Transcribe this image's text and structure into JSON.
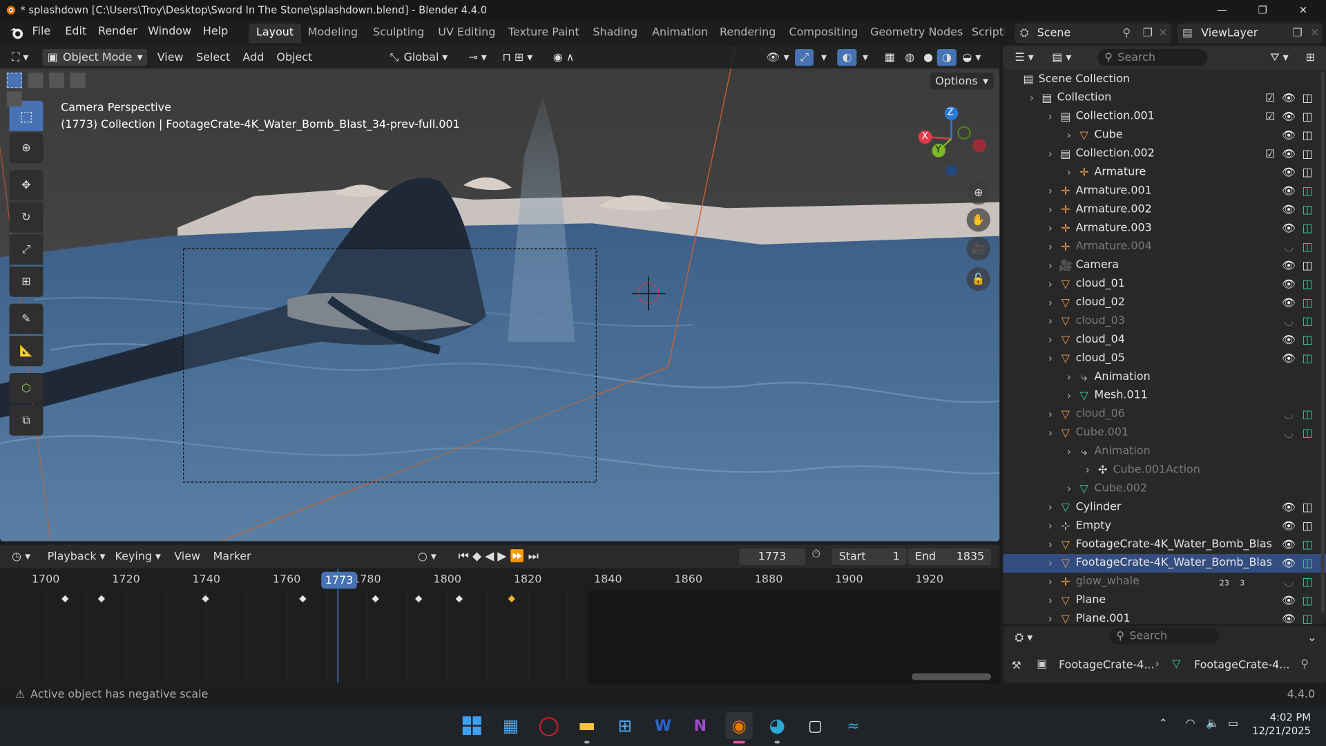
{
  "window": {
    "title": "* splashdown [C:\\Users\\Troy\\Desktop\\Sword In The Stone\\splashdown.blend] - Blender 4.4.0",
    "min": "—",
    "max": "❐",
    "close": "✕"
  },
  "menu": [
    "File",
    "Edit",
    "Render",
    "Window",
    "Help"
  ],
  "workspaces": [
    "Layout",
    "Modeling",
    "Sculpting",
    "UV Editing",
    "Texture Paint",
    "Shading",
    "Animation",
    "Rendering",
    "Compositing",
    "Geometry Nodes",
    "Scripti"
  ],
  "scene": {
    "name": "Scene",
    "viewlayer": "ViewLayer"
  },
  "viewport": {
    "mode": "Object Mode",
    "menus": [
      "View",
      "Select",
      "Add",
      "Object"
    ],
    "orientation": "Global",
    "options": "Options",
    "overlay_title": "Camera Perspective",
    "overlay_sub": "(1773) Collection | FootageCrate-4K_Water_Bomb_Blast_34-prev-full.001",
    "gizmo": {
      "z": "Z",
      "y": "Y",
      "x": "X"
    }
  },
  "timeline": {
    "menus": [
      "Playback",
      "Keying",
      "View",
      "Marker"
    ],
    "current_frame": "1773",
    "start_label": "Start",
    "start": "1",
    "end_label": "End",
    "end": "1835",
    "ticks": [
      "1700",
      "1720",
      "1740",
      "1760",
      "1780",
      "1800",
      "1820",
      "1840",
      "1860",
      "1880",
      "1900",
      "1920"
    ]
  },
  "status": {
    "message": "Active object has negative scale",
    "version": "4.4.0"
  },
  "outliner": {
    "search_placeholder": "Search",
    "rows": [
      {
        "name": "Scene Collection",
        "indent": 0
      },
      {
        "name": "Collection",
        "indent": 1
      },
      {
        "name": "Collection.001",
        "indent": 2
      },
      {
        "name": "Cube",
        "indent": 3
      },
      {
        "name": "Collection.002",
        "indent": 2
      },
      {
        "name": "Armature",
        "indent": 3
      },
      {
        "name": "Armature.001",
        "indent": 2
      },
      {
        "name": "Armature.002",
        "indent": 2
      },
      {
        "name": "Armature.003",
        "indent": 2
      },
      {
        "name": "Armature.004",
        "indent": 2,
        "dim": true
      },
      {
        "name": "Camera",
        "indent": 2
      },
      {
        "name": "cloud_01",
        "indent": 2
      },
      {
        "name": "cloud_02",
        "indent": 2
      },
      {
        "name": "cloud_03",
        "indent": 2,
        "dim": true
      },
      {
        "name": "cloud_04",
        "indent": 2
      },
      {
        "name": "cloud_05",
        "indent": 2
      },
      {
        "name": "Animation",
        "indent": 3
      },
      {
        "name": "Mesh.011",
        "indent": 3
      },
      {
        "name": "cloud_06",
        "indent": 2,
        "dim": true
      },
      {
        "name": "Cube.001",
        "indent": 2,
        "dim": true
      },
      {
        "name": "Animation",
        "indent": 3,
        "dim": true
      },
      {
        "name": "Cube.001Action",
        "indent": 4,
        "dim": true
      },
      {
        "name": "Cube.002",
        "indent": 3,
        "dim": true
      },
      {
        "name": "Cylinder",
        "indent": 2
      },
      {
        "name": "Empty",
        "indent": 2
      },
      {
        "name": "FootageCrate-4K_Water_Bomb_Blas",
        "indent": 2
      },
      {
        "name": "FootageCrate-4K_Water_Bomb_Blas",
        "indent": 2,
        "highlight": true
      },
      {
        "name": "glow_whale",
        "indent": 2,
        "dim": true
      },
      {
        "name": "Plane",
        "indent": 2
      },
      {
        "name": "Plane.001",
        "indent": 2
      }
    ],
    "glow_counts": [
      "23",
      "3"
    ]
  },
  "properties": {
    "search_placeholder": "Search",
    "crumb1": "FootageCrate-4...",
    "crumb2": "FootageCrate-4..."
  },
  "taskbar": {
    "time": "4:02 PM",
    "date": "12/21/2025"
  }
}
